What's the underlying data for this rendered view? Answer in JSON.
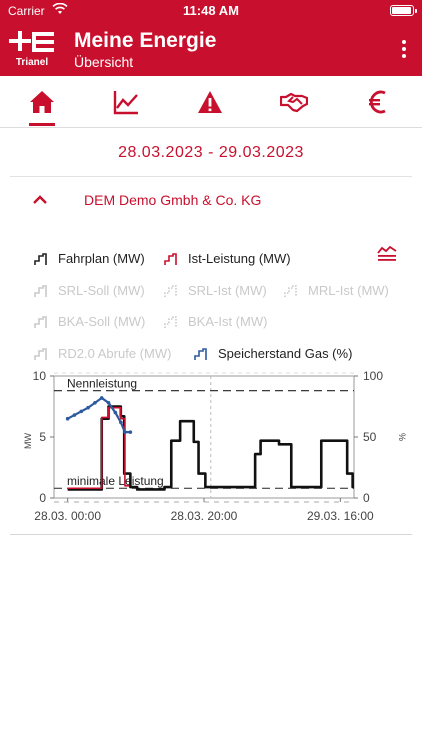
{
  "status_bar": {
    "carrier": "Carrier",
    "time": "11:48 AM"
  },
  "header": {
    "logo_text": "Trianel",
    "title": "Meine Energie",
    "subtitle": "Übersicht",
    "brand_color": "#c8102e"
  },
  "tabs": [
    {
      "icon": "home-icon",
      "active": true
    },
    {
      "icon": "line-chart-icon",
      "active": false
    },
    {
      "icon": "warning-icon",
      "active": false
    },
    {
      "icon": "handshake-icon",
      "active": false
    },
    {
      "icon": "euro-icon",
      "active": false
    }
  ],
  "date_range": "28.03.2023 - 29.03.2023",
  "company": {
    "name": "DEM Demo Gmbh & Co. KG",
    "expanded": true
  },
  "legend": [
    {
      "label": "Fahrplan (MW)",
      "active": true,
      "color": "#222222"
    },
    {
      "label": "Ist-Leistung (MW)",
      "active": true,
      "color": "#c8102e"
    },
    {
      "label": "SRL-Soll (MW)",
      "active": false
    },
    {
      "label": "SRL-Ist (MW)",
      "active": false
    },
    {
      "label": "MRL-Ist (MW)",
      "active": false
    },
    {
      "label": "BKA-Soll (MW)",
      "active": false
    },
    {
      "label": "BKA-Ist (MW)",
      "active": false
    },
    {
      "label": "RD2.0 Abrufe (MW)",
      "active": false
    },
    {
      "label": "Speicherstand Gas (%)",
      "active": true,
      "color": "#2e5a9e"
    }
  ],
  "chart_data": {
    "type": "line",
    "ylabel_left": "MW",
    "ylabel_right": "%",
    "ylim_left": [
      0,
      10
    ],
    "yticks_left": [
      "0",
      "5",
      "10"
    ],
    "ylim_right": [
      0,
      100
    ],
    "yticks_right": [
      "0",
      "50",
      "100"
    ],
    "xlim_hours": [
      -2,
      42
    ],
    "xticks": [
      {
        "label": "28.03. 00:00",
        "hour": 0
      },
      {
        "label": "28.03. 20:00",
        "hour": 20
      },
      {
        "label": "29.03. 16:00",
        "hour": 40
      }
    ],
    "reference_lines": [
      {
        "label": "Nennleistung",
        "value": 8.8
      },
      {
        "label": "minimale Leistung",
        "value": 0.8
      }
    ],
    "series": [
      {
        "name": "Fahrplan (MW)",
        "axis": "left",
        "color": "#111111",
        "steps": [
          [
            0,
            0.7
          ],
          [
            5,
            6.5
          ],
          [
            6,
            7.5
          ],
          [
            7.8,
            6.7
          ],
          [
            8.3,
            2.0
          ],
          [
            9.2,
            0.9
          ],
          [
            10.2,
            0.7
          ],
          [
            14.2,
            0.9
          ],
          [
            15.2,
            4.7
          ],
          [
            16.5,
            6.3
          ],
          [
            18.5,
            4.6
          ],
          [
            19.2,
            2.0
          ],
          [
            20.2,
            0.9
          ],
          [
            27.5,
            3.6
          ],
          [
            28.3,
            4.7
          ],
          [
            31,
            4.4
          ],
          [
            32.8,
            0.9
          ],
          [
            37.2,
            4.7
          ],
          [
            41,
            2.0
          ],
          [
            41.8,
            0.9
          ],
          [
            44,
            0.9
          ]
        ]
      },
      {
        "name": "Ist-Leistung (MW)",
        "axis": "left",
        "color": "#c8102e",
        "steps": [
          [
            0,
            0.8
          ],
          [
            5,
            6.6
          ],
          [
            6,
            7.4
          ],
          [
            7.8,
            6.5
          ],
          [
            8.4,
            1.0
          ],
          [
            9,
            1.0
          ]
        ]
      },
      {
        "name": "Speicherstand Gas (%)",
        "axis": "right",
        "color": "#2e5a9e",
        "points": [
          [
            0,
            65
          ],
          [
            1,
            68
          ],
          [
            2,
            71
          ],
          [
            3,
            74
          ],
          [
            4,
            78
          ],
          [
            5,
            82
          ],
          [
            6,
            78
          ],
          [
            7,
            70
          ],
          [
            7.8,
            62
          ],
          [
            8.4,
            54
          ],
          [
            9.2,
            54
          ]
        ]
      }
    ],
    "crosshair_hour": 21
  }
}
